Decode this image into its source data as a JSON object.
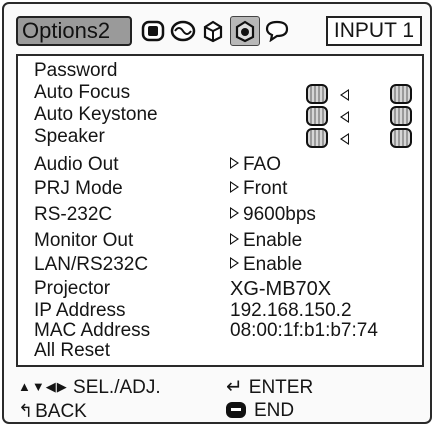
{
  "header": {
    "active_tab_label": "Options2",
    "icon_tabs": [
      {
        "name": "picture-tab-icon"
      },
      {
        "name": "signal-adjust-tab-icon"
      },
      {
        "name": "screen-setup-tab-icon"
      },
      {
        "name": "options-tab-icon",
        "selected": true
      },
      {
        "name": "language-tab-icon"
      }
    ],
    "input_label": "INPUT 1"
  },
  "menu": {
    "items": [
      {
        "label": "Password"
      },
      {
        "label": "Auto Focus",
        "control": "toggle"
      },
      {
        "label": "Auto Keystone",
        "control": "toggle"
      },
      {
        "label": "Speaker",
        "control": "toggle"
      },
      {
        "label": "Audio Out",
        "value": "FAO"
      },
      {
        "label": "PRJ Mode",
        "value": "Front"
      },
      {
        "label": "RS-232C",
        "value": "9600bps"
      },
      {
        "label": "Monitor Out",
        "value": "Enable"
      },
      {
        "label": "LAN/RS232C",
        "value": "Enable"
      },
      {
        "label": "Projector",
        "value": "XG-MB70X"
      },
      {
        "label": "IP Address",
        "value": "192.168.150.2"
      },
      {
        "label": "MAC Address",
        "value": "08:00:1f:b1:b7:74"
      },
      {
        "label": "All Reset"
      }
    ]
  },
  "footer": {
    "select_adjust": "SEL./ADJ.",
    "enter": "ENTER",
    "back": "BACK",
    "end": "END"
  }
}
